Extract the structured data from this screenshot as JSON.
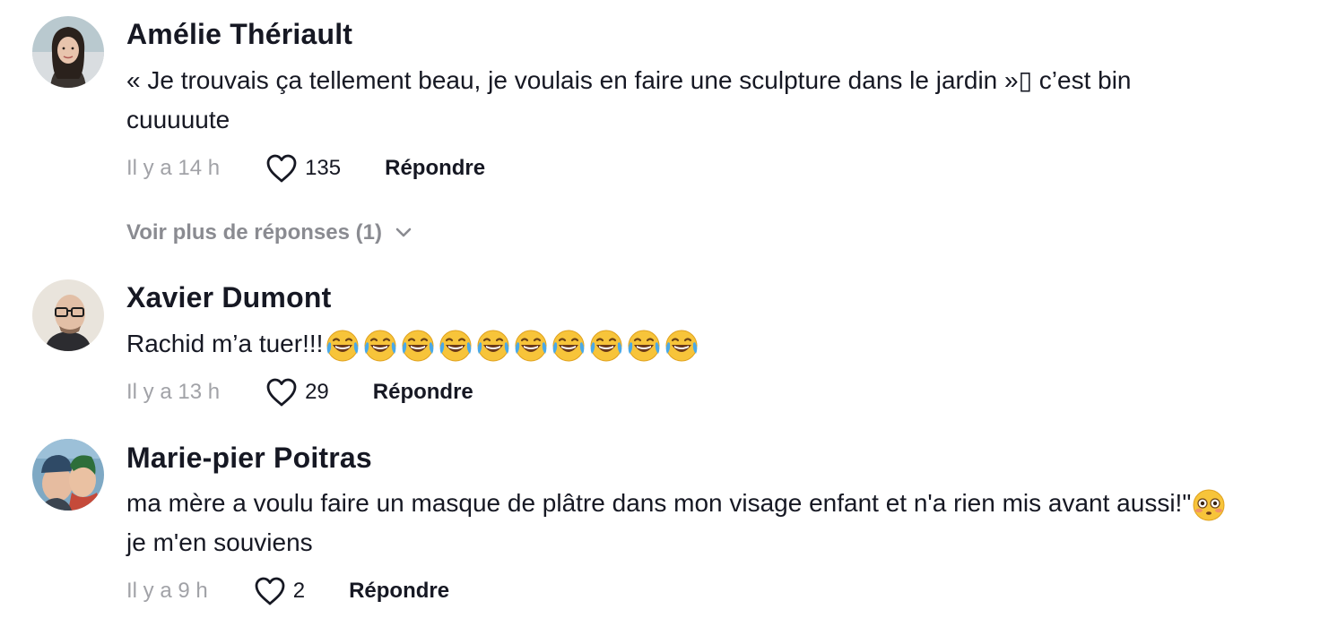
{
  "comments": [
    {
      "author": "Amélie Thériault",
      "text": "« Je trouvais ça tellement beau, je voulais en faire une sculpture dans le jardin »▯ c’est bin cuuuuute",
      "time": "Il y a 14 h",
      "likes": "135",
      "reply_label": "Répondre",
      "more_replies": "Voir plus de réponses (1)"
    },
    {
      "author": "Xavier Dumont",
      "text": "Rachid m’a tuer!!!",
      "emoji": "😂😂😂😂😂😂😂😂😂😂",
      "time": "Il y a 13 h",
      "likes": "29",
      "reply_label": "Répondre"
    },
    {
      "author": "Marie-pier Poitras",
      "text_part1": "ma mère a voulu faire un masque de plâtre dans mon visage enfant et n'a rien mis avant aussi!\"",
      "emoji": "😳",
      "text_part2": " je m'en souviens",
      "time": "Il y a 9 h",
      "likes": "2",
      "reply_label": "Répondre"
    }
  ],
  "icons": {
    "heart": "heart-outline-icon",
    "chevron": "chevron-down-icon",
    "emoji_laugh": "face-with-tears-of-joy",
    "emoji_flushed": "flushed-face"
  },
  "colors": {
    "text": "#161823",
    "muted": "#a1a2a7",
    "more": "#8a8b91"
  }
}
